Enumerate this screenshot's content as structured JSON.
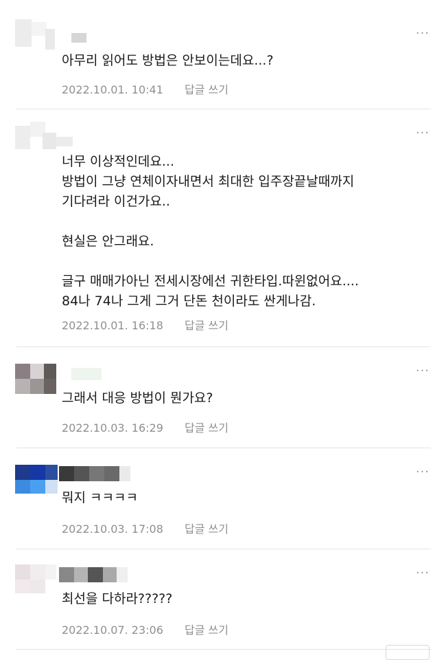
{
  "comments": [
    {
      "text": "아무리 읽어도 방법은 안보이는데요...?",
      "date": "2022.10.01. 10:41",
      "reply_label": "답글 쓰기",
      "more_label": "···"
    },
    {
      "text": "너무 이상적인데요...\n방법이 그냥 연체이자내면서 최대한 입주장끝날때까지\n기다려라 이건가요..\n\n현실은 안그래요.\n\n글구 매매가아닌 전세시장에선 귀한타입.따윈없어요....\n84나 74나 그게 그거 단돈 천이라도 싼게나감.",
      "date": "2022.10.01. 16:18",
      "reply_label": "답글 쓰기",
      "more_label": "···"
    },
    {
      "text": "그래서 대응 방법이 뭔가요?",
      "date": "2022.10.03. 16:29",
      "reply_label": "답글 쓰기",
      "more_label": "···"
    },
    {
      "text": "뭐지 ㅋㅋㅋㅋ",
      "date": "2022.10.03. 17:08",
      "reply_label": "답글 쓰기",
      "more_label": "···"
    },
    {
      "text": "최선을 다하라?????",
      "date": "2022.10.07. 23:06",
      "reply_label": "답글 쓰기",
      "more_label": "···"
    }
  ]
}
